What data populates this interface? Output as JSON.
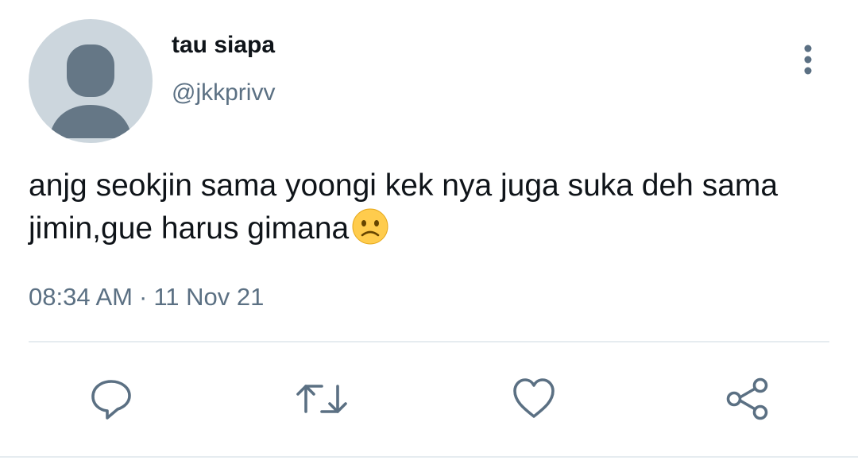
{
  "author": {
    "display_name": "tau siapa",
    "handle": "@jkkprivv",
    "avatar_icon": "default-profile-icon"
  },
  "tweet": {
    "text": "anjg seokjin sama yoongi kek nya juga suka deh sama jimin,gue harus gimana",
    "emoji": "slightly-frowning-face",
    "time": "08:34 AM",
    "separator": "·",
    "date": "11 Nov 21"
  },
  "actions": {
    "reply": "reply-icon",
    "retweet": "retweet-icon",
    "like": "heart-icon",
    "share": "share-icon",
    "more": "more-vertical-icon"
  },
  "colors": {
    "text_primary": "#0f1419",
    "text_secondary": "#5b7083",
    "avatar_bg": "#ccd6dd",
    "avatar_fg": "#657786",
    "divider": "#e6ecf0",
    "emoji_face": "#ffcc4d"
  }
}
